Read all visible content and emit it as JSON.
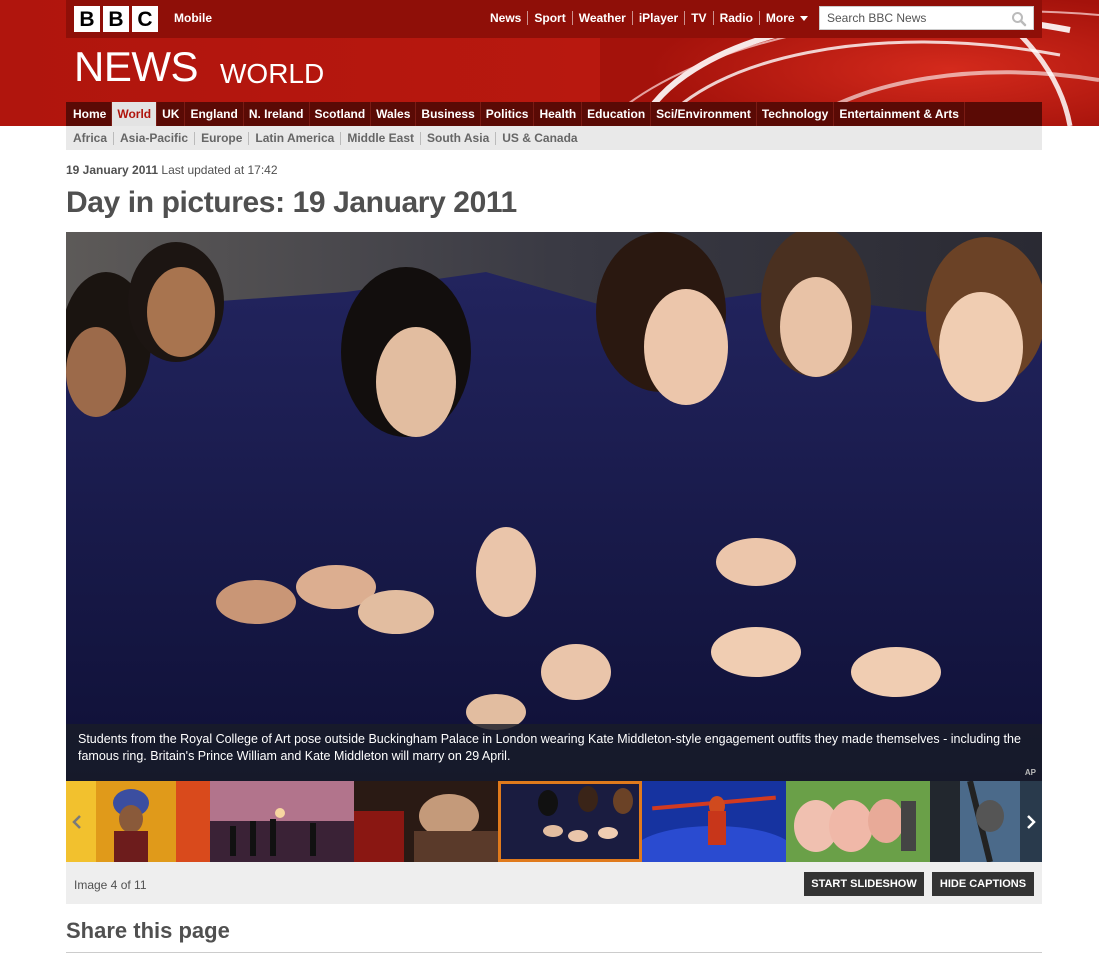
{
  "masthead": {
    "logo_letters": [
      "B",
      "B",
      "C"
    ],
    "mobile_label": "Mobile",
    "top_nav": [
      "News",
      "Sport",
      "Weather",
      "iPlayer",
      "TV",
      "Radio"
    ],
    "more_label": "More",
    "search_placeholder": "Search BBC News",
    "section_title": "NEWS",
    "section_subtitle": "WORLD",
    "brand_color": "#b0150d"
  },
  "primary_nav": {
    "items": [
      "Home",
      "World",
      "UK",
      "England",
      "N. Ireland",
      "Scotland",
      "Wales",
      "Business",
      "Politics",
      "Health",
      "Education",
      "Sci/Environment",
      "Technology",
      "Entertainment & Arts"
    ],
    "active": "World"
  },
  "secondary_nav": {
    "items": [
      "Africa",
      "Asia-Pacific",
      "Europe",
      "Latin America",
      "Middle East",
      "South Asia",
      "US & Canada"
    ]
  },
  "article": {
    "date": "19 January 2011",
    "updated": "Last updated at 17:42",
    "title": "Day in pictures: 19 January 2011"
  },
  "gallery": {
    "caption": "Students from the Royal College of Art pose outside Buckingham Palace in London wearing Kate Middleton-style engagement outfits they made themselves - including the famous ring. Britain's Prince William and Kate Middleton will marry on 29 April.",
    "credit": "AP",
    "counter": "Image 4 of 11",
    "selected_index": 3,
    "start_slideshow_label": "START SLIDESHOW",
    "hide_captions_label": "HIDE CAPTIONS",
    "selected_color": "#e07a1c"
  },
  "share": {
    "title": "Share this page"
  }
}
